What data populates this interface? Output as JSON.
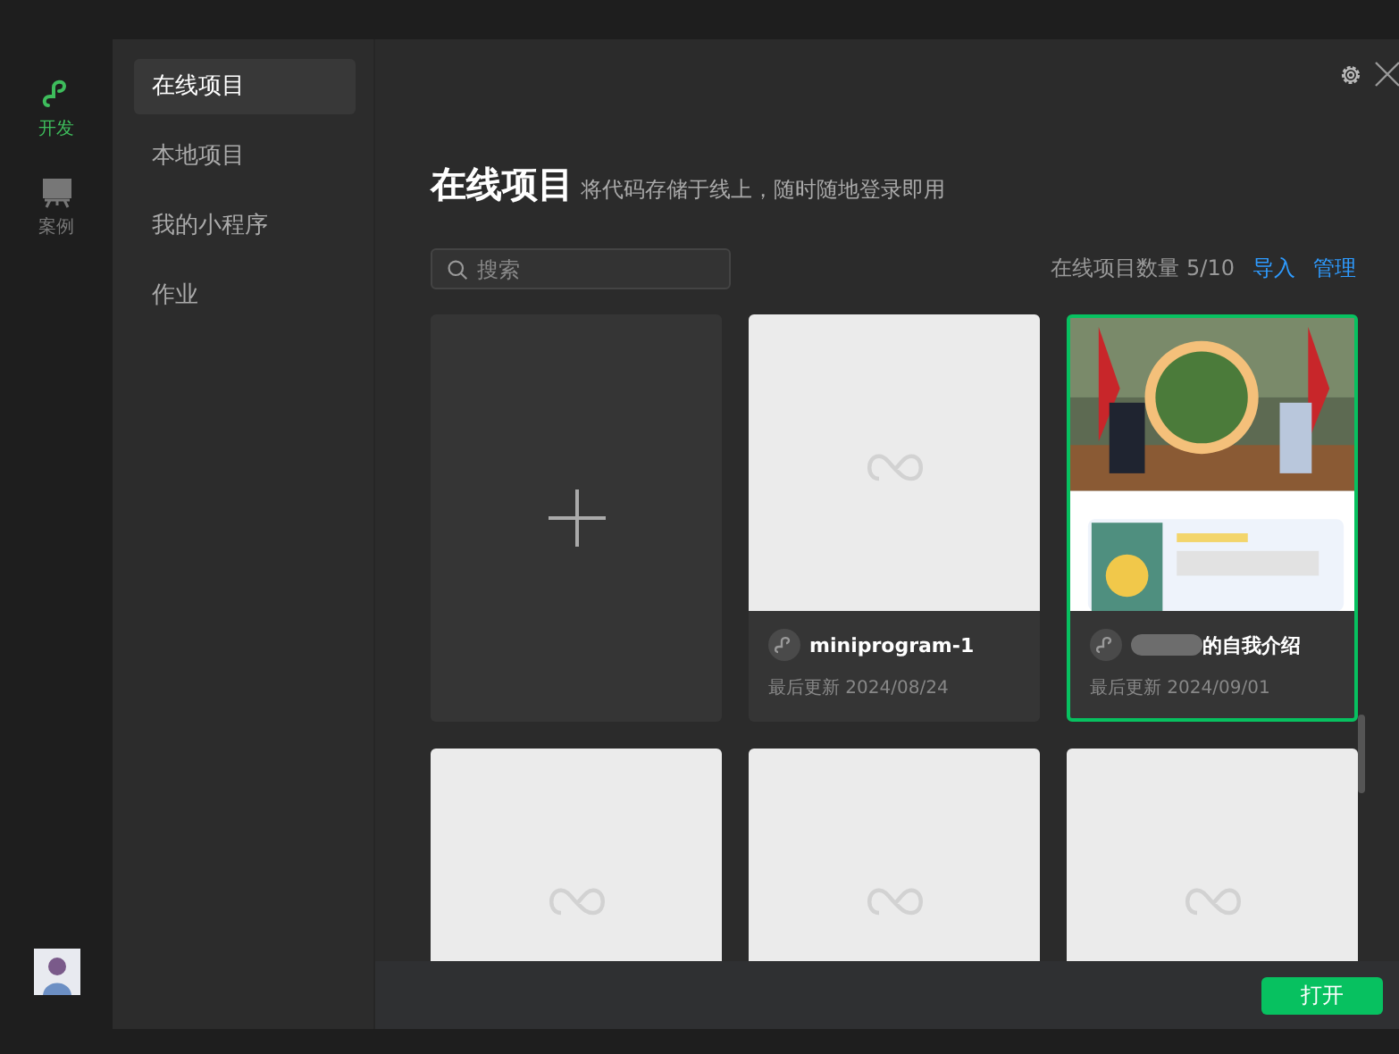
{
  "rail": {
    "items": [
      {
        "label": "开发",
        "kind": "dev",
        "selected": true
      },
      {
        "label": "案例",
        "kind": "cases",
        "selected": false
      }
    ]
  },
  "nav": {
    "items": [
      {
        "label": "在线项目",
        "selected": true
      },
      {
        "label": "本地项目",
        "selected": false
      },
      {
        "label": "我的小程序",
        "selected": false
      },
      {
        "label": "作业",
        "selected": false
      }
    ]
  },
  "header": {
    "title": "在线项目",
    "subtitle": "将代码存储于线上，随时随地登录即用"
  },
  "search": {
    "placeholder": "搜索"
  },
  "toolbar": {
    "count": "在线项目数量 5/10",
    "links": [
      "导入",
      "管理"
    ]
  },
  "cards": [
    {
      "kind": "new",
      "selected": false
    },
    {
      "kind": "empty",
      "title": "miniprogram-1",
      "updated": "最后更新 2024/08/24",
      "selected": false
    },
    {
      "kind": "picture",
      "title": "的自我介绍",
      "redacted": true,
      "updated": "最后更新 2024/09/01",
      "selected": true
    },
    {
      "kind": "empty",
      "selected": false
    },
    {
      "kind": "empty",
      "selected": false
    },
    {
      "kind": "empty",
      "selected": false
    }
  ],
  "footer": {
    "button": "打开"
  }
}
